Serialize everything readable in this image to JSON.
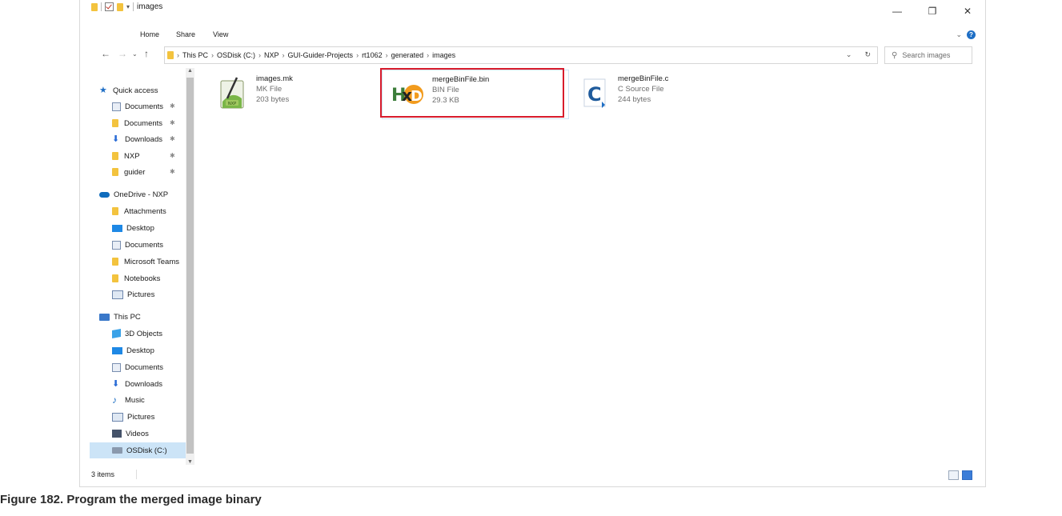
{
  "window": {
    "title": "images",
    "caption_buttons": [
      "—",
      "❐",
      "✕"
    ]
  },
  "ribbon": {
    "tabs": [
      "Home",
      "Share",
      "View"
    ]
  },
  "address_bar": {
    "breadcrumbs": [
      "This PC",
      "OSDisk (C:)",
      "NXP",
      "GUI-Guider-Projects",
      "rt1062",
      "generated",
      "images"
    ],
    "dropdown_glyph": "⌄",
    "refresh_glyph": "↻"
  },
  "search": {
    "placeholder": "Search images"
  },
  "navigation": {
    "quick_access": {
      "label": "Quick access",
      "items": [
        {
          "label": "Documents",
          "icon": "documents-icon"
        },
        {
          "label": "Documents",
          "icon": "folder-icon"
        },
        {
          "label": "Downloads",
          "icon": "downloads-icon"
        },
        {
          "label": "NXP",
          "icon": "folder-icon"
        },
        {
          "label": "guider",
          "icon": "folder-icon"
        }
      ]
    },
    "onedrive": {
      "label": "OneDrive - NXP",
      "items": [
        {
          "label": "Attachments",
          "icon": "folder-icon"
        },
        {
          "label": "Desktop",
          "icon": "desktop-icon"
        },
        {
          "label": "Documents",
          "icon": "documents-icon"
        },
        {
          "label": "Microsoft Teams",
          "icon": "folder-icon"
        },
        {
          "label": "Notebooks",
          "icon": "folder-icon"
        },
        {
          "label": "Pictures",
          "icon": "pictures-icon"
        }
      ]
    },
    "this_pc": {
      "label": "This PC",
      "items": [
        {
          "label": "3D Objects",
          "icon": "3d-objects-icon"
        },
        {
          "label": "Desktop",
          "icon": "desktop-icon"
        },
        {
          "label": "Documents",
          "icon": "documents-icon"
        },
        {
          "label": "Downloads",
          "icon": "downloads-icon"
        },
        {
          "label": "Music",
          "icon": "music-icon"
        },
        {
          "label": "Pictures",
          "icon": "pictures-icon"
        },
        {
          "label": "Videos",
          "icon": "videos-icon"
        },
        {
          "label": "OSDisk (C:)",
          "icon": "disk-icon",
          "selected": true
        }
      ]
    }
  },
  "files": [
    {
      "name": "images.mk",
      "type": "MK File",
      "size": "203 bytes",
      "icon": "notepad-plus-plus-icon"
    },
    {
      "name": "mergeBinFile.bin",
      "type": "BIN File",
      "size": "29.3 KB",
      "icon": "hxd-hex-editor-icon",
      "highlighted": true
    },
    {
      "name": "mergeBinFile.c",
      "type": "C Source File",
      "size": "244 bytes",
      "icon": "c-source-icon"
    }
  ],
  "status": {
    "item_count": "3 items"
  },
  "figure_caption": "Figure 182.  Program the merged image binary",
  "colors": {
    "highlight_border": "#d81c2c",
    "selected_nav": "#cce4f7",
    "folder": "#f3c33e",
    "accent": "#1f6fc5"
  }
}
